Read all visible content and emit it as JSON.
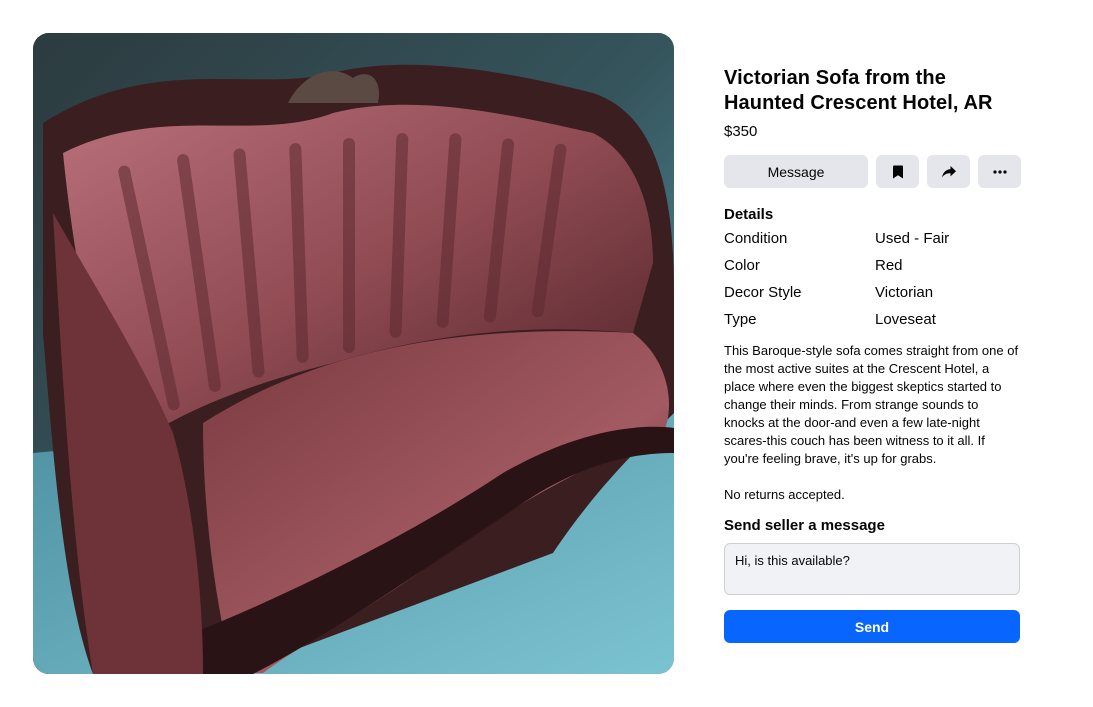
{
  "listing": {
    "title_line1": "Victorian Sofa from the",
    "title_line2": "Haunted Crescent Hotel, AR",
    "price": "$350"
  },
  "actions": {
    "message_label": "Message",
    "save_icon": "bookmark-icon",
    "share_icon": "share-icon",
    "more_icon": "more-icon"
  },
  "details": {
    "heading": "Details",
    "rows": [
      {
        "key": "Condition",
        "value": "Used - Fair"
      },
      {
        "key": "Color",
        "value": "Red"
      },
      {
        "key": "Decor Style",
        "value": "Victorian"
      },
      {
        "key": "Type",
        "value": "Loveseat"
      }
    ],
    "description": "This Baroque-style sofa comes straight from one of the most active suites at the Crescent Hotel, a place where even the biggest skeptics started to change their minds. From strange sounds to knocks at the door-and even a few late-night scares-this couch has been witness to it all. If you're feeling brave, it's up for grabs.",
    "returns": "No returns accepted."
  },
  "message": {
    "heading": "Send seller a message",
    "value": "Hi, is this available?",
    "send_label": "Send"
  },
  "colors": {
    "send_button": "#0866ff",
    "secondary_button": "#e4e6eb",
    "input_bg": "#f0f2f5"
  }
}
